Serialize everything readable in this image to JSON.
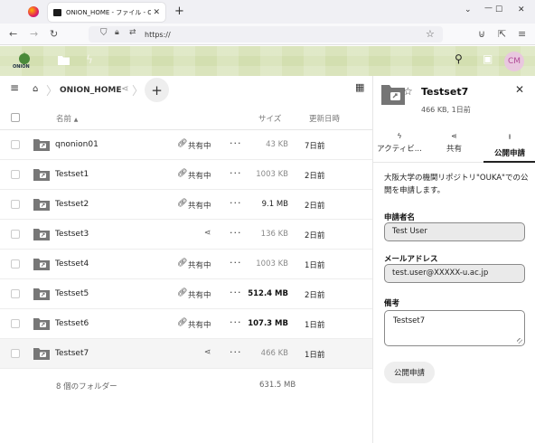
{
  "browser": {
    "tab_title": "ONION_HOME - ファイル - ONION",
    "url": "https://"
  },
  "app": {
    "logo_text": "ONION",
    "avatar_initials": "CM"
  },
  "breadcrumb": {
    "folder": "ONION_HOME"
  },
  "table": {
    "headers": {
      "name": "名前",
      "size": "サイズ",
      "modified": "更新日時"
    },
    "rows": [
      {
        "name": "qnonion01",
        "shared": true,
        "share_label": "共有中",
        "size": "43 KB",
        "size_color": "#8a8a8a",
        "size_bold": false,
        "modified": "7日前"
      },
      {
        "name": "Testset1",
        "shared": true,
        "share_label": "共有中",
        "size": "1003 KB",
        "size_color": "#8a8a8a",
        "size_bold": false,
        "modified": "2日前"
      },
      {
        "name": "Testset2",
        "shared": true,
        "share_label": "共有中",
        "size": "9.1 MB",
        "size_color": "#222222",
        "size_bold": false,
        "modified": "2日前"
      },
      {
        "name": "Testset3",
        "shared": false,
        "share_label": "",
        "size": "136 KB",
        "size_color": "#8a8a8a",
        "size_bold": false,
        "modified": "2日前"
      },
      {
        "name": "Testset4",
        "shared": true,
        "share_label": "共有中",
        "size": "1003 KB",
        "size_color": "#8a8a8a",
        "size_bold": false,
        "modified": "1日前"
      },
      {
        "name": "Testset5",
        "shared": true,
        "share_label": "共有中",
        "size": "512.4 MB",
        "size_color": "#111111",
        "size_bold": true,
        "modified": "2日前"
      },
      {
        "name": "Testset6",
        "shared": true,
        "share_label": "共有中",
        "size": "107.3 MB",
        "size_color": "#111111",
        "size_bold": true,
        "modified": "1日前"
      },
      {
        "name": "Testset7",
        "shared": false,
        "share_label": "",
        "size": "466 KB",
        "size_color": "#8a8a8a",
        "size_bold": false,
        "modified": "1日前"
      }
    ],
    "summary": {
      "count": "8 個のフォルダー",
      "total": "631.5 MB"
    }
  },
  "sidebar": {
    "title": "Testset7",
    "meta": "466 KB, 1日前",
    "tabs": [
      {
        "label": "アクティビ...",
        "icon": "bolt-icon"
      },
      {
        "label": "共有",
        "icon": "share-icon"
      },
      {
        "label": "公開申請",
        "icon": "upload-icon"
      }
    ],
    "description": "大阪大学の機関リポジトリ\"OUKA\"での公開を申請します。",
    "applicant_label": "申請者名",
    "applicant_value": "Test User",
    "email_label": "メールアドレス",
    "email_value": "test.user@XXXXX-u.ac.jp",
    "notes_label": "備考",
    "notes_value": "Testset7",
    "submit_label": "公開申請"
  }
}
